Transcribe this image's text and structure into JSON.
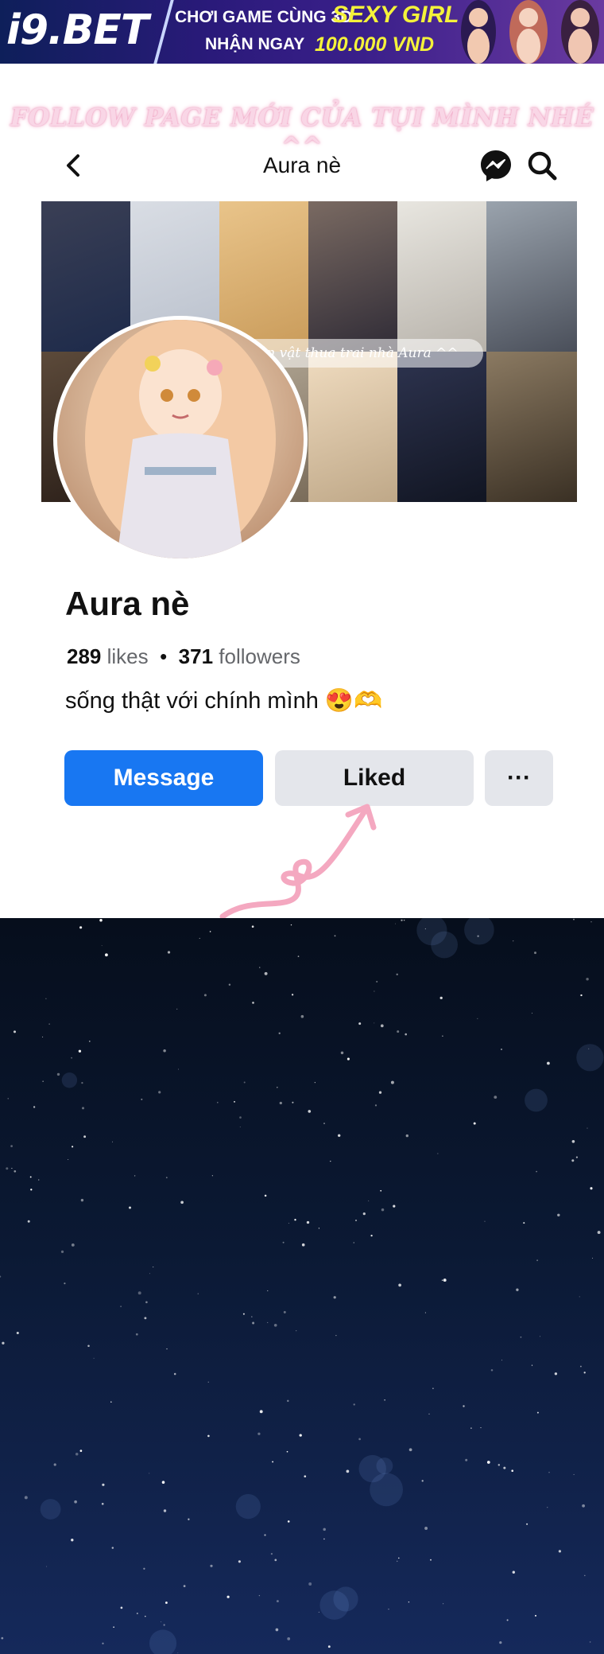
{
  "ad": {
    "logo": "i9.BET",
    "line1": "CHƠI GAME CÙNG 3D",
    "highlight1": "SEXY GIRL",
    "line2": "NHẬN NGAY",
    "highlight2": "100.000 VND"
  },
  "banner_text": "FOLLOW PAGE MỚI CỦA TỤI MÌNH NHÉ ^^",
  "header": {
    "back_icon": "chevron-left-icon",
    "title": "Aura nè",
    "messenger_icon": "messenger-icon",
    "search_icon": "search-icon"
  },
  "cover": {
    "caption": "Nhân vật thua trai nhà Aura ^^"
  },
  "profile": {
    "name": "Aura nè",
    "likes_count": "289",
    "likes_label": "likes",
    "separator": "•",
    "followers_count": "371",
    "followers_label": "followers",
    "bio": "sống thật với chính mình 😍🫶"
  },
  "actions": {
    "message_label": "Message",
    "liked_label": "Liked",
    "more_label": "···"
  },
  "colors": {
    "primary_button": "#1877f2",
    "secondary_button": "#e4e6eb",
    "annotation_pink": "#f4a8c0",
    "night_sky": "#0b1934"
  }
}
